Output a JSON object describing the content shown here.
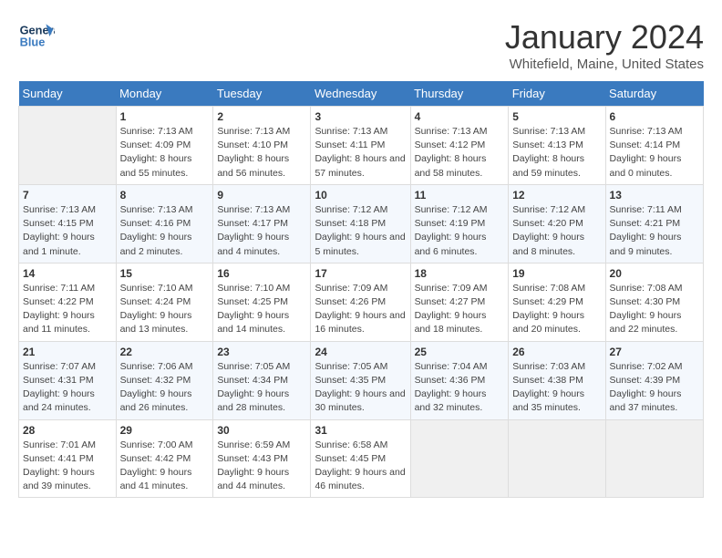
{
  "header": {
    "logo_general": "General",
    "logo_blue": "Blue",
    "title": "January 2024",
    "location": "Whitefield, Maine, United States"
  },
  "days_of_week": [
    "Sunday",
    "Monday",
    "Tuesday",
    "Wednesday",
    "Thursday",
    "Friday",
    "Saturday"
  ],
  "weeks": [
    [
      {
        "day": "",
        "empty": true
      },
      {
        "day": "1",
        "sunrise": "7:13 AM",
        "sunset": "4:09 PM",
        "daylight": "8 hours and 55 minutes."
      },
      {
        "day": "2",
        "sunrise": "7:13 AM",
        "sunset": "4:10 PM",
        "daylight": "8 hours and 56 minutes."
      },
      {
        "day": "3",
        "sunrise": "7:13 AM",
        "sunset": "4:11 PM",
        "daylight": "8 hours and 57 minutes."
      },
      {
        "day": "4",
        "sunrise": "7:13 AM",
        "sunset": "4:12 PM",
        "daylight": "8 hours and 58 minutes."
      },
      {
        "day": "5",
        "sunrise": "7:13 AM",
        "sunset": "4:13 PM",
        "daylight": "8 hours and 59 minutes."
      },
      {
        "day": "6",
        "sunrise": "7:13 AM",
        "sunset": "4:14 PM",
        "daylight": "9 hours and 0 minutes."
      }
    ],
    [
      {
        "day": "7",
        "sunrise": "7:13 AM",
        "sunset": "4:15 PM",
        "daylight": "9 hours and 1 minute."
      },
      {
        "day": "8",
        "sunrise": "7:13 AM",
        "sunset": "4:16 PM",
        "daylight": "9 hours and 2 minutes."
      },
      {
        "day": "9",
        "sunrise": "7:13 AM",
        "sunset": "4:17 PM",
        "daylight": "9 hours and 4 minutes."
      },
      {
        "day": "10",
        "sunrise": "7:12 AM",
        "sunset": "4:18 PM",
        "daylight": "9 hours and 5 minutes."
      },
      {
        "day": "11",
        "sunrise": "7:12 AM",
        "sunset": "4:19 PM",
        "daylight": "9 hours and 6 minutes."
      },
      {
        "day": "12",
        "sunrise": "7:12 AM",
        "sunset": "4:20 PM",
        "daylight": "9 hours and 8 minutes."
      },
      {
        "day": "13",
        "sunrise": "7:11 AM",
        "sunset": "4:21 PM",
        "daylight": "9 hours and 9 minutes."
      }
    ],
    [
      {
        "day": "14",
        "sunrise": "7:11 AM",
        "sunset": "4:22 PM",
        "daylight": "9 hours and 11 minutes."
      },
      {
        "day": "15",
        "sunrise": "7:10 AM",
        "sunset": "4:24 PM",
        "daylight": "9 hours and 13 minutes."
      },
      {
        "day": "16",
        "sunrise": "7:10 AM",
        "sunset": "4:25 PM",
        "daylight": "9 hours and 14 minutes."
      },
      {
        "day": "17",
        "sunrise": "7:09 AM",
        "sunset": "4:26 PM",
        "daylight": "9 hours and 16 minutes."
      },
      {
        "day": "18",
        "sunrise": "7:09 AM",
        "sunset": "4:27 PM",
        "daylight": "9 hours and 18 minutes."
      },
      {
        "day": "19",
        "sunrise": "7:08 AM",
        "sunset": "4:29 PM",
        "daylight": "9 hours and 20 minutes."
      },
      {
        "day": "20",
        "sunrise": "7:08 AM",
        "sunset": "4:30 PM",
        "daylight": "9 hours and 22 minutes."
      }
    ],
    [
      {
        "day": "21",
        "sunrise": "7:07 AM",
        "sunset": "4:31 PM",
        "daylight": "9 hours and 24 minutes."
      },
      {
        "day": "22",
        "sunrise": "7:06 AM",
        "sunset": "4:32 PM",
        "daylight": "9 hours and 26 minutes."
      },
      {
        "day": "23",
        "sunrise": "7:05 AM",
        "sunset": "4:34 PM",
        "daylight": "9 hours and 28 minutes."
      },
      {
        "day": "24",
        "sunrise": "7:05 AM",
        "sunset": "4:35 PM",
        "daylight": "9 hours and 30 minutes."
      },
      {
        "day": "25",
        "sunrise": "7:04 AM",
        "sunset": "4:36 PM",
        "daylight": "9 hours and 32 minutes."
      },
      {
        "day": "26",
        "sunrise": "7:03 AM",
        "sunset": "4:38 PM",
        "daylight": "9 hours and 35 minutes."
      },
      {
        "day": "27",
        "sunrise": "7:02 AM",
        "sunset": "4:39 PM",
        "daylight": "9 hours and 37 minutes."
      }
    ],
    [
      {
        "day": "28",
        "sunrise": "7:01 AM",
        "sunset": "4:41 PM",
        "daylight": "9 hours and 39 minutes."
      },
      {
        "day": "29",
        "sunrise": "7:00 AM",
        "sunset": "4:42 PM",
        "daylight": "9 hours and 41 minutes."
      },
      {
        "day": "30",
        "sunrise": "6:59 AM",
        "sunset": "4:43 PM",
        "daylight": "9 hours and 44 minutes."
      },
      {
        "day": "31",
        "sunrise": "6:58 AM",
        "sunset": "4:45 PM",
        "daylight": "9 hours and 46 minutes."
      },
      {
        "day": "",
        "empty": true
      },
      {
        "day": "",
        "empty": true
      },
      {
        "day": "",
        "empty": true
      }
    ]
  ]
}
